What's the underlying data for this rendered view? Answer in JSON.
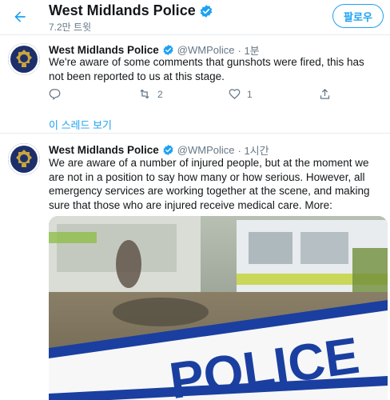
{
  "header": {
    "title": "West Midlands Police",
    "subtitle": "7.2만 트윗",
    "follow_label": "팔로우"
  },
  "tweets": [
    {
      "name": "West Midlands Police",
      "handle": "@WMPolice",
      "time": "· 1분",
      "text": "We're aware of some comments that gunshots were fired, this has not been reported to us at this stage.",
      "reply_count": "",
      "retweet_count": "2",
      "like_count": "1"
    },
    {
      "name": "West Midlands Police",
      "handle": "@WMPolice",
      "time": "· 1시간",
      "text": "We are aware of a number of injured people, but at the moment we are not in a position to say how many or how serious. However, all emergency services are working together at the scene, and making sure that those who are injured receive medical care. More:",
      "media_text": "POLICE"
    }
  ],
  "thread_link": "이 스레드 보기",
  "colors": {
    "accent": "#1da1f2",
    "text": "#14171a",
    "muted": "#657786",
    "border": "#e6ecf0"
  }
}
